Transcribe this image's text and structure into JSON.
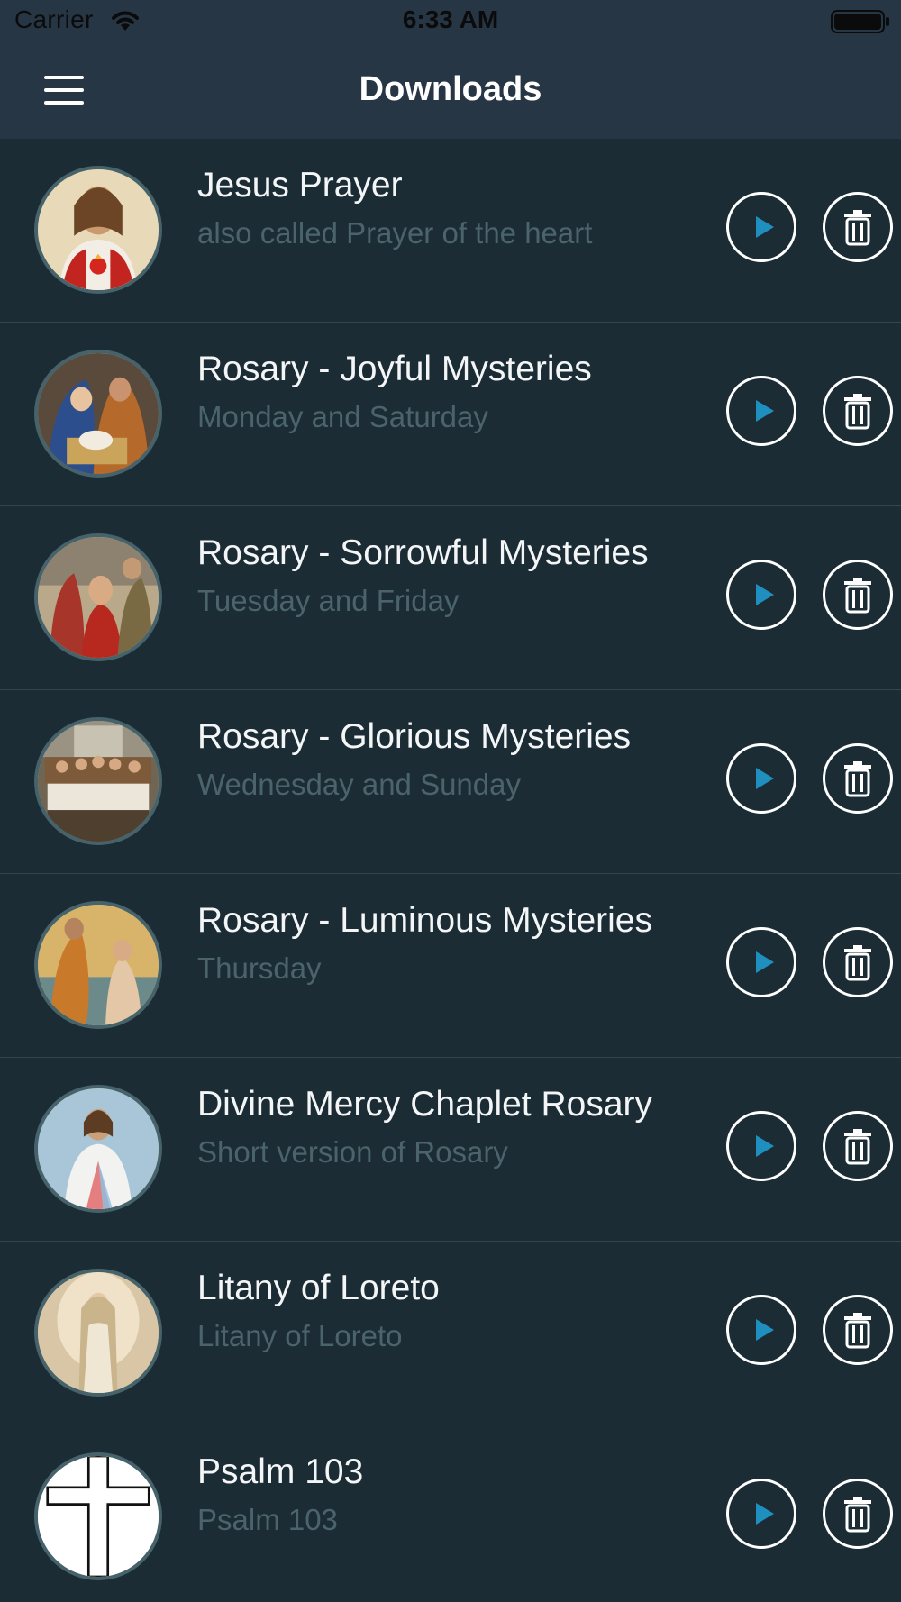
{
  "status_bar": {
    "carrier": "Carrier",
    "time": "6:33 AM"
  },
  "nav": {
    "title": "Downloads"
  },
  "colors": {
    "background": "#1b2c35",
    "header": "#263645",
    "title_text": "#f3f5f6",
    "subtitle_text": "#4b636b",
    "play_accent": "#1f8fc0"
  },
  "downloads": [
    {
      "title": "Jesus Prayer",
      "subtitle": "also called Prayer of the heart",
      "image": "sacred-heart-of-jesus"
    },
    {
      "title": "Rosary - Joyful Mysteries",
      "subtitle": "Monday and Saturday",
      "image": "nativity"
    },
    {
      "title": "Rosary - Sorrowful Mysteries",
      "subtitle": "Tuesday and Friday",
      "image": "crowning-with-thorns"
    },
    {
      "title": "Rosary - Glorious Mysteries",
      "subtitle": "Wednesday and Sunday",
      "image": "last-supper"
    },
    {
      "title": "Rosary - Luminous Mysteries",
      "subtitle": "Thursday",
      "image": "baptism-of-jesus"
    },
    {
      "title": "Divine Mercy Chaplet Rosary",
      "subtitle": "Short version of Rosary",
      "image": "divine-mercy"
    },
    {
      "title": "Litany of Loreto",
      "subtitle": "Litany of Loreto",
      "image": "virgin-mary"
    },
    {
      "title": "Psalm 103",
      "subtitle": "Psalm 103",
      "image": "cross"
    }
  ],
  "icons": {
    "menu": "hamburger-menu-icon",
    "play": "play-icon",
    "delete": "trash-icon"
  }
}
